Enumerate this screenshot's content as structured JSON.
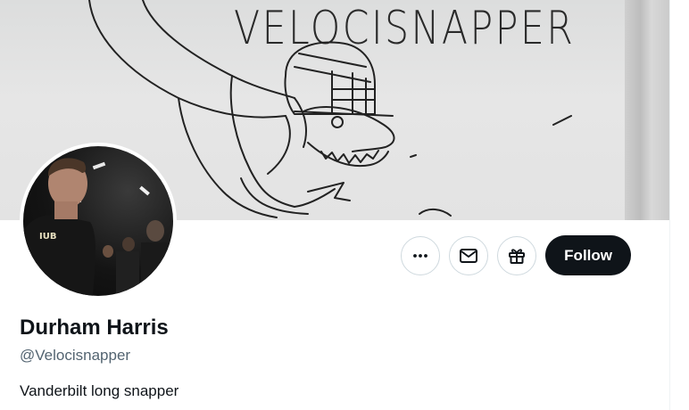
{
  "banner": {
    "text": "VELOCISNAPPER",
    "description_icon": "dinosaur-football-helmet-drawing"
  },
  "profile": {
    "name": "Durham Harris",
    "handle": "@Velocisnapper",
    "bio": "Vanderbilt long snapper"
  },
  "actions": {
    "more_icon": "more-icon",
    "message_icon": "envelope-icon",
    "gift_icon": "gift-icon",
    "follow_label": "Follow"
  },
  "colors": {
    "follow_bg": "#0f1419",
    "handle": "#536471",
    "border": "#cfd9de"
  }
}
